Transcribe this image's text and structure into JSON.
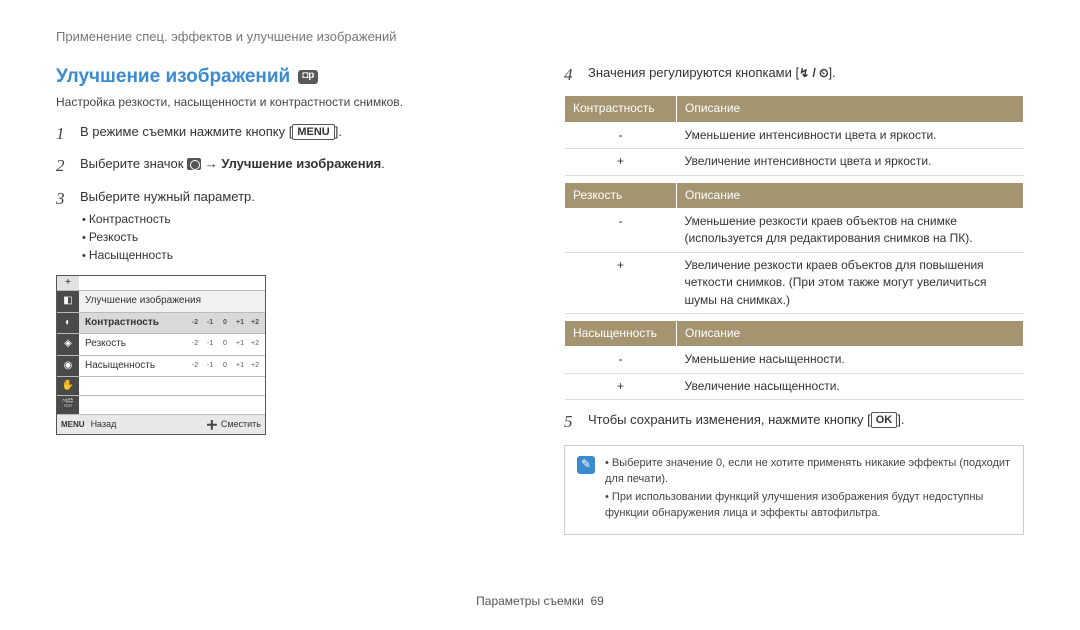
{
  "breadcrumb": "Применение спец. эффектов и улучшение изображений",
  "section_title": "Улучшение изображений",
  "mode_badge": "◘p",
  "subtitle": "Настройка резкости, насыщенности и контрастности снимков.",
  "steps": {
    "s1_prefix": "В режиме съемки нажмите кнопку [",
    "s1_button": "MENU",
    "s1_suffix": "].",
    "s2_prefix": "Выберите значок ",
    "s2_arrow": " → ",
    "s2_bold": "Улучшение изображения",
    "s2_suffix": ".",
    "s3": "Выберите нужный параметр.",
    "s3_bullets": [
      "Контрастность",
      "Резкость",
      "Насыщенность"
    ],
    "s4_prefix": "Значения регулируются кнопками [",
    "s4_icons": "↯ / ⏲",
    "s4_suffix": "].",
    "s5_prefix": "Чтобы сохранить изменения, нажмите кнопку [",
    "s5_button": "OK",
    "s5_suffix": "]."
  },
  "lcd": {
    "title": "Улучшение изображения",
    "rows": [
      {
        "label": "Контрастность",
        "selected": true
      },
      {
        "label": "Резкость",
        "selected": false
      },
      {
        "label": "Насыщенность",
        "selected": false
      }
    ],
    "scale": [
      "-2",
      "-1",
      "0",
      "+1",
      "+2"
    ],
    "footer": {
      "back_key": "MENU",
      "back_label": "Назад",
      "move_label": "Сместить"
    }
  },
  "tables": [
    {
      "headers": [
        "Контрастность",
        "Описание"
      ],
      "rows": [
        {
          "k": "-",
          "v": "Уменьшение интенсивности цвета и яркости."
        },
        {
          "k": "+",
          "v": "Увеличение интенсивности цвета и яркости."
        }
      ]
    },
    {
      "headers": [
        "Резкость",
        "Описание"
      ],
      "rows": [
        {
          "k": "-",
          "v": "Уменьшение резкости краев объектов на снимке (используется для редактирования снимков на ПК)."
        },
        {
          "k": "+",
          "v": "Увеличение резкости краев объектов для повышения четкости снимков. (При этом также могут увеличиться шумы на снимках.)"
        }
      ]
    },
    {
      "headers": [
        "Насыщенность",
        "Описание"
      ],
      "rows": [
        {
          "k": "-",
          "v": "Уменьшение насыщенности."
        },
        {
          "k": "+",
          "v": "Увеличение насыщенности."
        }
      ]
    }
  ],
  "notes": [
    "Выберите значение 0, если не хотите применять никакие эффекты (подходит для печати).",
    "При использовании функций улучшения изображения будут недоступны функции обнаружения лица и эффекты автофильтра."
  ],
  "footer": {
    "label": "Параметры съемки",
    "page": "69"
  }
}
